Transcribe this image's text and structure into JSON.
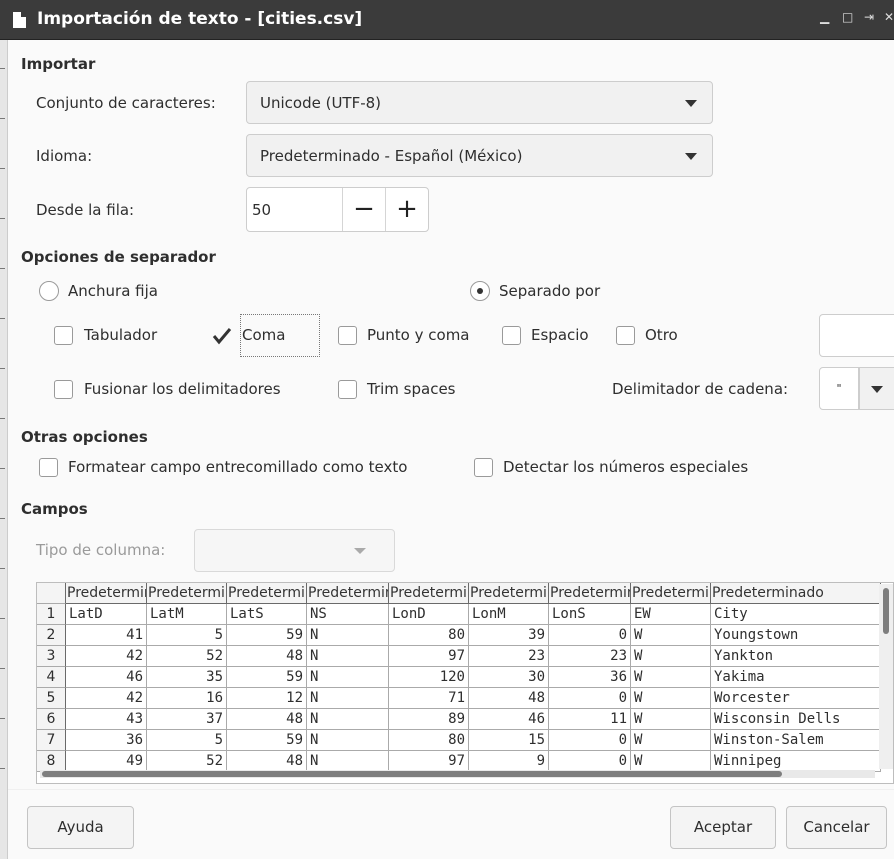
{
  "window": {
    "title": "Importación de texto - [cities.csv]",
    "controls": {
      "minimize": "▁",
      "maximize": "□",
      "pin": "⇥",
      "close": "✕"
    }
  },
  "import": {
    "heading": "Importar",
    "charset_label": "Conjunto de caracteres:",
    "charset_value": "Unicode (UTF-8)",
    "language_label": "Idioma:",
    "language_value": "Predeterminado - Español (México)",
    "from_row_label": "Desde la fila:",
    "from_row_value": "50",
    "minus": "−",
    "plus": "+"
  },
  "separator": {
    "heading": "Opciones de separador",
    "fixed_width": {
      "label": "Anchura fija",
      "selected": false
    },
    "separated_by": {
      "label": "Separado por",
      "selected": true
    },
    "tab": {
      "label": "Tabulador",
      "checked": false
    },
    "comma": {
      "label": "Coma",
      "checked": true
    },
    "semicolon": {
      "label": "Punto y coma",
      "checked": false
    },
    "space": {
      "label": "Espacio",
      "checked": false
    },
    "other": {
      "label": "Otro",
      "checked": false,
      "value": ""
    },
    "merge": {
      "label": "Fusionar los delimitadores",
      "checked": false
    },
    "trim": {
      "label": "Trim spaces",
      "checked": false
    },
    "string_delim_label": "Delimitador de cadena:",
    "string_delim_value": "\""
  },
  "other_options": {
    "heading": "Otras opciones",
    "quoted_as_text": {
      "label": "Formatear campo entrecomillado como texto",
      "checked": false
    },
    "special_numbers": {
      "label": "Detectar los números especiales",
      "checked": false
    }
  },
  "fields": {
    "heading": "Campos",
    "column_type_label": "Tipo de columna:",
    "column_type_value": "",
    "column_headers": [
      "Predeterminado",
      "Predeterminado",
      "Predeterminado",
      "Predeterminado",
      "Predeterminado",
      "Predeterminado",
      "Predeterminado",
      "Predeterminado",
      "Predeterminado"
    ],
    "row_numbers": [
      "1",
      "2",
      "3",
      "4",
      "5",
      "6",
      "7",
      "8"
    ],
    "rows": [
      [
        "LatD",
        "LatM",
        "LatS",
        "NS",
        "LonD",
        "LonM",
        "LonS",
        "EW",
        "City"
      ],
      [
        "41",
        "5",
        "59",
        "N",
        "80",
        "39",
        "0",
        "W",
        "Youngstown"
      ],
      [
        "42",
        "52",
        "48",
        "N",
        "97",
        "23",
        "23",
        "W",
        "Yankton"
      ],
      [
        "46",
        "35",
        "59",
        "N",
        "120",
        "30",
        "36",
        "W",
        "Yakima"
      ],
      [
        "42",
        "16",
        "12",
        "N",
        "71",
        "48",
        "0",
        "W",
        "Worcester"
      ],
      [
        "43",
        "37",
        "48",
        "N",
        "89",
        "46",
        "11",
        "W",
        "Wisconsin Dells"
      ],
      [
        "36",
        "5",
        "59",
        "N",
        "80",
        "15",
        "0",
        "W",
        "Winston-Salem"
      ],
      [
        "49",
        "52",
        "48",
        "N",
        "97",
        "9",
        "0",
        "W",
        "Winnipeg"
      ]
    ]
  },
  "buttons": {
    "help": "Ayuda",
    "ok": "Aceptar",
    "cancel": "Cancelar"
  },
  "colors": {
    "titlebar": "#3b3b3b",
    "background": "#fafafa",
    "border": "#cdcdcd"
  }
}
